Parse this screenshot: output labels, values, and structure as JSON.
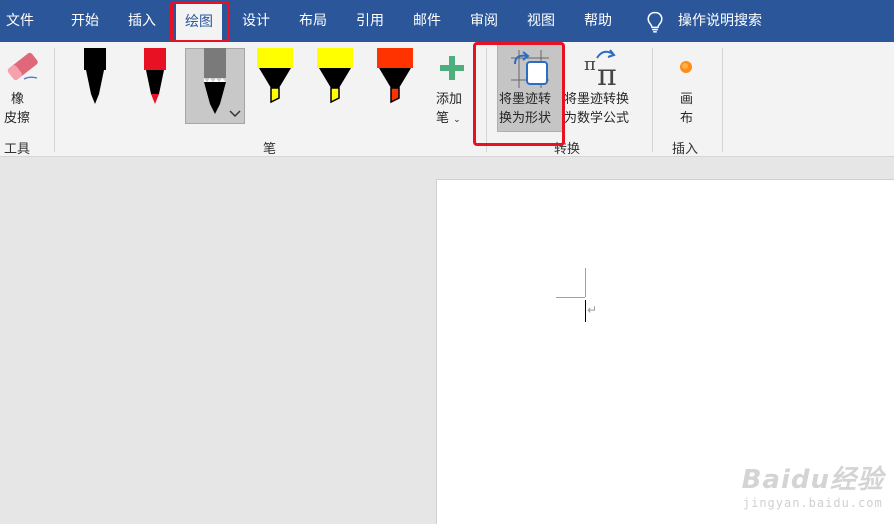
{
  "menubar": {
    "tabs": [
      "文件",
      "开始",
      "插入",
      "绘图",
      "设计",
      "布局",
      "引用",
      "邮件",
      "审阅",
      "视图",
      "帮助"
    ],
    "active_tab": "绘图",
    "search_label": "操作说明搜索"
  },
  "ribbon": {
    "tools": {
      "eraser_label_line1": "橡",
      "eraser_label_line2": "皮擦",
      "group_label": "工具"
    },
    "pens": {
      "items": [
        {
          "name": "black-pen",
          "color": "#000000",
          "kind": "pen"
        },
        {
          "name": "red-pen",
          "color": "#e81123",
          "kind": "pen"
        },
        {
          "name": "gray-pencil",
          "color": "#7a7a7a",
          "kind": "pencil",
          "selected": true
        },
        {
          "name": "yellow-highlighter-1",
          "color": "#ffff00",
          "kind": "highlighter"
        },
        {
          "name": "yellow-highlighter-2",
          "color": "#ffff00",
          "kind": "highlighter"
        },
        {
          "name": "red-highlighter",
          "color": "#ff3300",
          "kind": "highlighter"
        }
      ],
      "add_pen_line1": "添加",
      "add_pen_line2": "笔",
      "group_label": "笔"
    },
    "convert": {
      "ink_to_shape_line1": "将墨迹转",
      "ink_to_shape_line2": "换为形状",
      "ink_to_math_line1": "将墨迹转换",
      "ink_to_math_line2": "为数学公式",
      "group_label": "转换"
    },
    "insert": {
      "canvas_line1": "画",
      "canvas_line2": "布",
      "group_label": "插入"
    }
  },
  "document": {
    "paragraph_mark": "↵"
  },
  "watermark": {
    "brand": "Baidu经验",
    "url": "jingyan.baidu.com"
  },
  "colors": {
    "menubar": "#2b579a",
    "highlight": "#e81123",
    "ribbon": "#f3f3f3"
  }
}
